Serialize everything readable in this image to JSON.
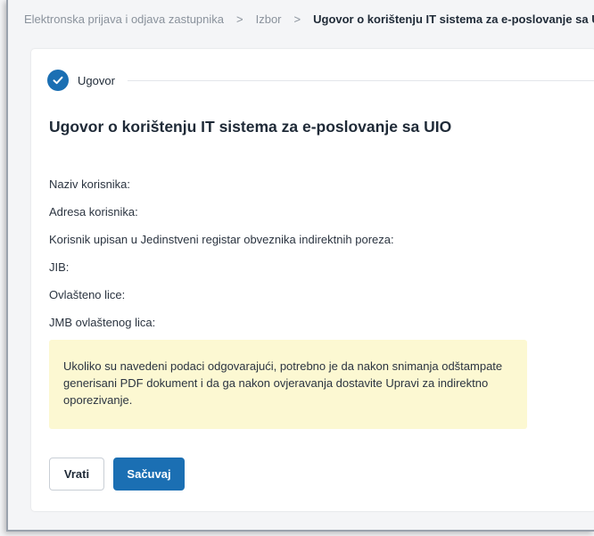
{
  "breadcrumb": {
    "items": [
      "Elektronska prijava i odjava zastupnika",
      "Izbor",
      "Ugovor o korištenju IT sistema za e-poslovanje sa UIO"
    ],
    "separator": ">"
  },
  "step": {
    "label": "Ugovor",
    "icon": "check-circle-icon",
    "color": "#1b6fb3"
  },
  "form": {
    "title": "Ugovor o korištenju IT sistema za e-poslovanje sa UIO",
    "fields": [
      "Naziv korisnika:",
      "Adresa korisnika:",
      "Korisnik upisan u Jedinstveni registar obveznika indirektnih poreza:",
      "JIB:",
      "Ovlašteno lice:",
      "JMB ovlaštenog lica:"
    ],
    "notice": "Ukoliko su navedeni podaci odgovarajući, potrebno je da nakon snimanja odštampate generisani PDF dokument i da ga nakon ovjeravanja dostavite Upravi za indirektno oporezivanje.",
    "notice_color": "#fcf8d2"
  },
  "buttons": {
    "back_label": "Vrati",
    "save_label": "Sačuvaj",
    "primary_color": "#1b6fb3"
  }
}
